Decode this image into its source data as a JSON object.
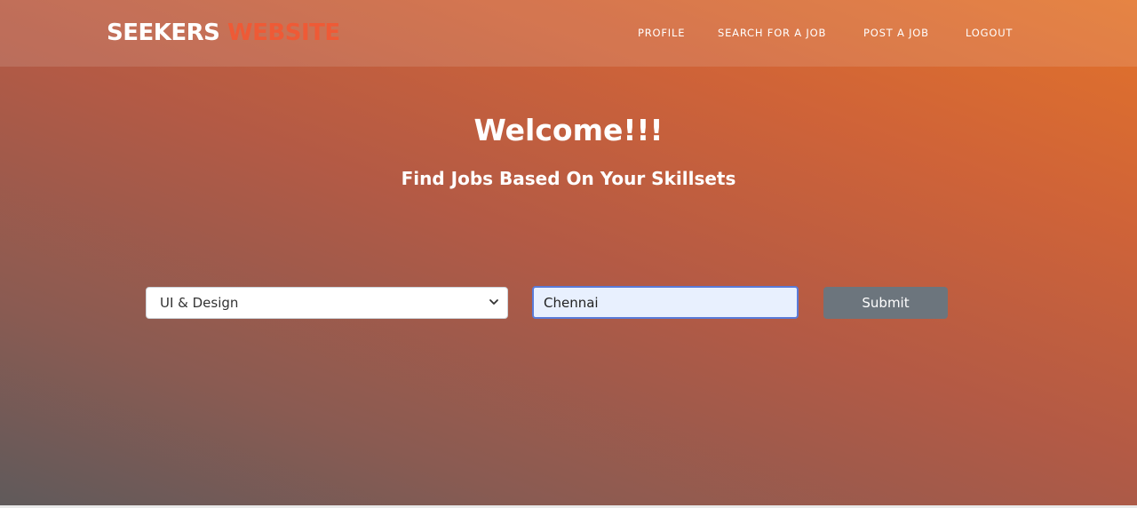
{
  "navbar": {
    "brand_part1": "SEEKERS",
    "brand_part2": "WEBSITE",
    "links": [
      "PROFILE",
      "SEARCH FOR A JOB",
      "POST A JOB",
      "LOGOUT"
    ]
  },
  "hero": {
    "title": "Welcome!!!",
    "subtitle": "Find Jobs Based On Your Skillsets"
  },
  "form": {
    "skill_selected": "UI & Design",
    "location_value": "Chennai",
    "submit_label": "Submit"
  },
  "colors": {
    "brand_accent": "#ee5a36",
    "button_bg": "#6c757d",
    "input_focus_border": "#5a7bd8",
    "input_bg": "#e8f0fe"
  },
  "icons": {
    "select_arrow": "chevron-down-icon"
  }
}
